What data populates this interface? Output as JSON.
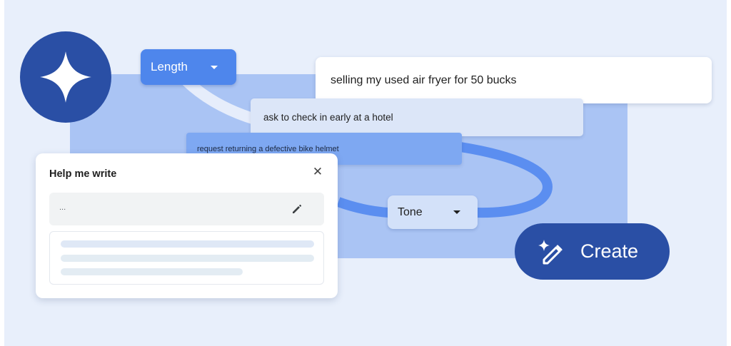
{
  "chips": {
    "length_label": "Length",
    "tone_label": "Tone"
  },
  "prompts": [
    "selling my used air fryer for 50 bucks",
    "ask to check in early at a hotel",
    "request returning a defective bike helmet"
  ],
  "card": {
    "title": "Help me write",
    "close_symbol": "✕",
    "input_value": "...",
    "result_lines_count": 3
  },
  "create_button": {
    "label": "Create"
  },
  "icons": {
    "logo": "sparkle-star-icon",
    "length_caret": "caret-down-icon",
    "tone_caret": "caret-down-icon",
    "close": "close-icon",
    "edit": "pencil-icon",
    "create": "sparkle-pen-icon"
  },
  "colors": {
    "background": "#e8effb",
    "panel": "#aac4f4",
    "brand_dark": "#2a4fa5",
    "ring": "#5b8ef0",
    "length_chip": "#4e86ec",
    "tone_chip": "#d3e1f9",
    "prompt_1": "#ffffff",
    "prompt_2": "#dce6f8",
    "prompt_3": "#7ea8f2",
    "skeleton": "#dfe8f6"
  }
}
